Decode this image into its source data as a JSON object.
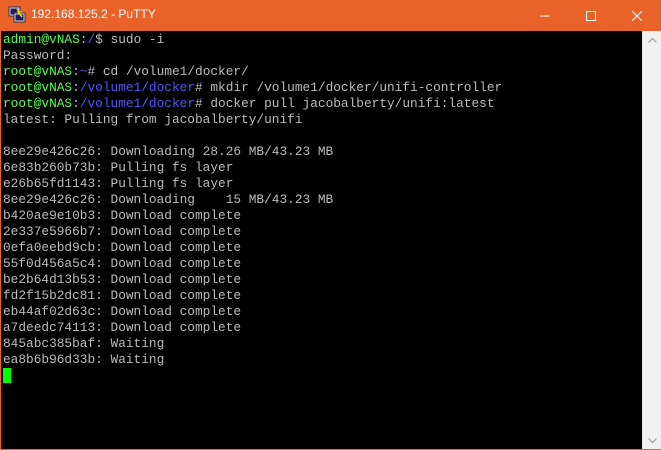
{
  "window": {
    "title": "192.168.125.2 - PuTTY"
  },
  "colors": {
    "titlebar": "#e8622a",
    "terminal_bg": "#000000",
    "text": "#bbbbbb",
    "prompt_green": "#55ff55",
    "path_blue": "#5555ff",
    "cursor": "#00ff00"
  },
  "terminal": {
    "line1": {
      "user": "admin@vNAS",
      "colon": ":",
      "path": "/",
      "suffix": "$ ",
      "cmd": "sudo -i"
    },
    "line2": {
      "text": "Password:"
    },
    "line3": {
      "user": "root@vNAS",
      "colon": ":",
      "path": "~",
      "suffix": "# ",
      "cmd": "cd /volume1/docker/"
    },
    "line4": {
      "user": "root@vNAS",
      "colon": ":",
      "path": "/volume1/docker",
      "suffix": "# ",
      "cmd": "mkdir /volume1/docker/unifi-controller"
    },
    "line5": {
      "user": "root@vNAS",
      "colon": ":",
      "path": "/volume1/docker",
      "suffix": "# ",
      "cmd": "docker pull jacobalberty/unifi:latest"
    },
    "line6": {
      "text": "latest: Pulling from jacobalberty/unifi"
    },
    "line7": {
      "text": ""
    },
    "line8": {
      "text": "8ee29e426c26: Downloading 28.26 MB/43.23 MB"
    },
    "line9": {
      "text": "6e83b260b73b: Pulling fs layer"
    },
    "line10": {
      "text": "e26b65fd1143: Pulling fs layer"
    },
    "line11": {
      "text": "8ee29e426c26: Downloading    15 MB/43.23 MB"
    },
    "line12": {
      "text": "b420ae9e10b3: Download complete"
    },
    "line13": {
      "text": "2e337e5966b7: Download complete"
    },
    "line14": {
      "text": "0efa0eebd9cb: Download complete"
    },
    "line15": {
      "text": "55f0d456a5c4: Download complete"
    },
    "line16": {
      "text": "be2b64d13b53: Download complete"
    },
    "line17": {
      "text": "fd2f15b2dc81: Download complete"
    },
    "line18": {
      "text": "eb44af02d63c: Download complete"
    },
    "line19": {
      "text": "a7deedc74113: Download complete"
    },
    "line20": {
      "text": "845abc385baf: Waiting"
    },
    "line21": {
      "text": "ea8b6b96d33b: Waiting"
    }
  }
}
